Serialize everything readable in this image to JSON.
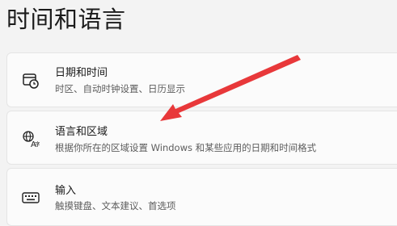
{
  "page": {
    "title": "时间和语言"
  },
  "settings": [
    {
      "title": "日期和时间",
      "description": "时区、自动时钟设置、日历显示",
      "icon": "clock-calendar-icon"
    },
    {
      "title": "语言和区域",
      "description": "根据你所在的区域设置 Windows 和某些应用的日期和时间格式",
      "icon": "language-globe-icon"
    },
    {
      "title": "输入",
      "description": "触摸键盘、文本建议、首选项",
      "icon": "keyboard-icon"
    }
  ],
  "annotation": {
    "arrow_color": "#e8383a"
  }
}
